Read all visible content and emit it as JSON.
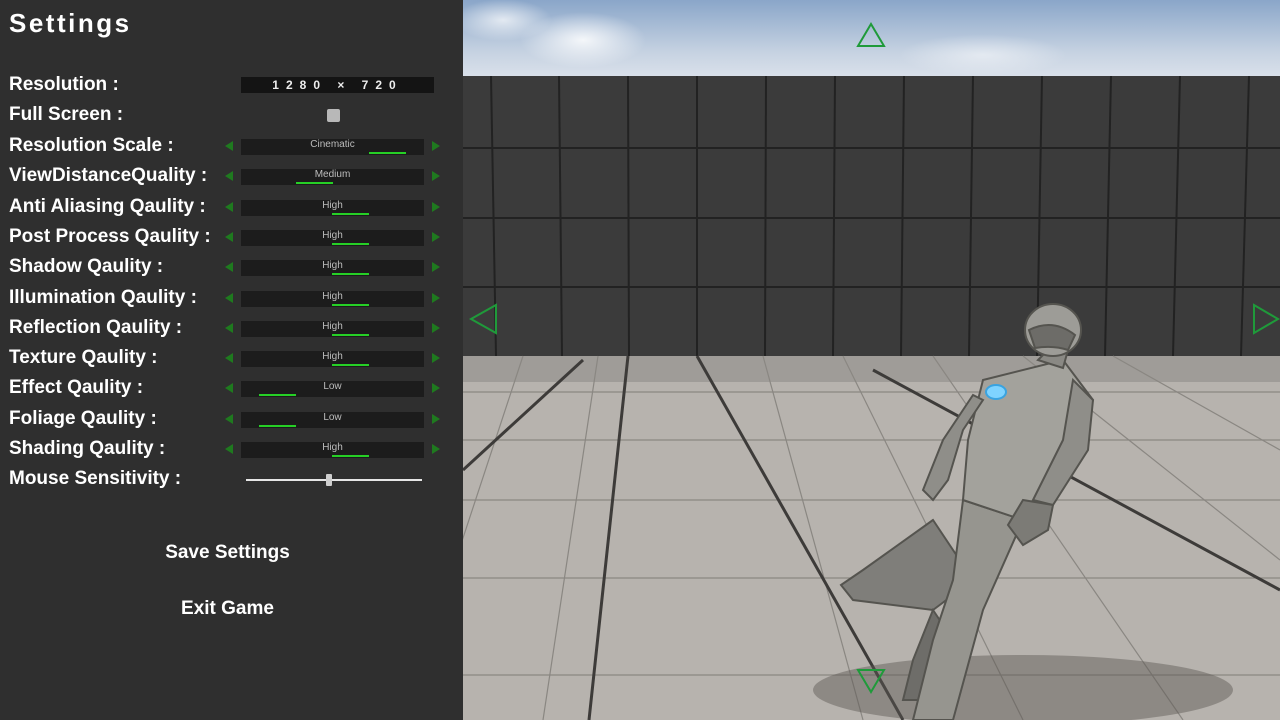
{
  "settings": {
    "title": "Settings",
    "resolution": {
      "label": "Resolution :",
      "value": "1280 × 720"
    },
    "fullscreen": {
      "label": "Full Screen :",
      "checked": false
    },
    "quality_rows": [
      {
        "label": "Resolution Scale :",
        "value": "Cinematic",
        "level": 0.8
      },
      {
        "label": "ViewDistanceQuality :",
        "value": "Medium",
        "level": 0.4
      },
      {
        "label": "Anti Aliasing Qaulity :",
        "value": "High",
        "level": 0.6
      },
      {
        "label": "Post Process Qaulity :",
        "value": "High",
        "level": 0.6
      },
      {
        "label": "Shadow Qaulity :",
        "value": "High",
        "level": 0.6
      },
      {
        "label": "Illumination Qaulity :",
        "value": "High",
        "level": 0.6
      },
      {
        "label": "Reflection Qaulity :",
        "value": "High",
        "level": 0.6
      },
      {
        "label": "Texture Qaulity :",
        "value": "High",
        "level": 0.6
      },
      {
        "label": "Effect Qaulity :",
        "value": "Low",
        "level": 0.2
      },
      {
        "label": "Foliage Qaulity :",
        "value": "Low",
        "level": 0.2
      },
      {
        "label": "Shading Qaulity :",
        "value": "High",
        "level": 0.6
      }
    ],
    "mouse_sensitivity": {
      "label": "Mouse Sensitivity :",
      "value": 0.47
    },
    "save_label": "Save Settings",
    "exit_label": "Exit Game"
  },
  "colors": {
    "panel_bg": "#2f2f2f",
    "accent_green": "#26d026",
    "arrow_green": "#1f9a3a"
  },
  "viewport": {
    "nav_arrows": [
      "up-arrow-icon",
      "left-arrow-icon",
      "right-arrow-icon",
      "down-arrow-icon"
    ]
  }
}
